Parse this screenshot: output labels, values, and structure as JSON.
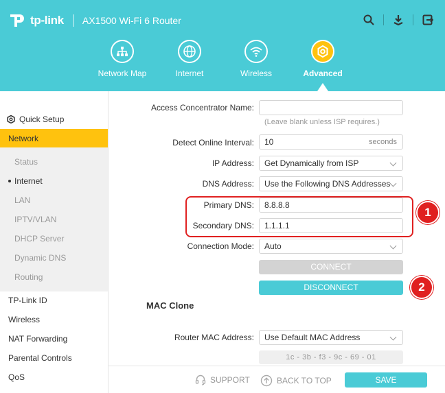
{
  "header": {
    "brand": "tp-link",
    "router_name": "AX1500 Wi-Fi 6 Router",
    "icons": [
      "search-icon",
      "download-icon",
      "logout-icon"
    ],
    "nav": [
      {
        "label": "Network Map",
        "icon": "network-map-icon"
      },
      {
        "label": "Internet",
        "icon": "globe-icon"
      },
      {
        "label": "Wireless",
        "icon": "wifi-icon"
      },
      {
        "label": "Advanced",
        "icon": "gear-icon",
        "active": true
      }
    ],
    "accent": "#4acbd6",
    "active_color": "#ffc20e"
  },
  "sidebar": {
    "quick_setup": "Quick Setup",
    "network": "Network",
    "sub_items": [
      "Status",
      "Internet",
      "LAN",
      "IPTV/VLAN",
      "DHCP Server",
      "Dynamic DNS",
      "Routing"
    ],
    "current_sub": "Internet",
    "items": [
      "TP-Link ID",
      "Wireless",
      "NAT Forwarding",
      "Parental Controls",
      "QoS"
    ]
  },
  "form": {
    "access_concentrator_label": "Access Concentrator Name:",
    "access_concentrator_value": "",
    "access_concentrator_hint": "(Leave blank unless ISP requires.)",
    "detect_interval_label": "Detect Online Interval:",
    "detect_interval_value": "10",
    "detect_interval_unit": "seconds",
    "ip_address_label": "IP Address:",
    "ip_address_value": "Get Dynamically from ISP",
    "dns_address_label": "DNS Address:",
    "dns_address_value": "Use the Following DNS Addresses",
    "primary_dns_label": "Primary DNS:",
    "primary_dns_value": "8.8.8.8",
    "secondary_dns_label": "Secondary DNS:",
    "secondary_dns_value": "1.1.1.1",
    "connection_mode_label": "Connection Mode:",
    "connection_mode_value": "Auto",
    "connect_label": "CONNECT",
    "disconnect_label": "DISCONNECT",
    "mac_clone_title": "MAC Clone",
    "router_mac_label": "Router MAC Address:",
    "router_mac_value": "Use Default MAC Address",
    "mac_octets": "1c  -  3b  -  f3  -  9c  -  69  -  01"
  },
  "annotations": {
    "marker_1": "1",
    "marker_2": "2",
    "highlight_color": "#e02020"
  },
  "footer": {
    "support": "SUPPORT",
    "back_to_top": "BACK TO TOP",
    "save": "SAVE"
  }
}
